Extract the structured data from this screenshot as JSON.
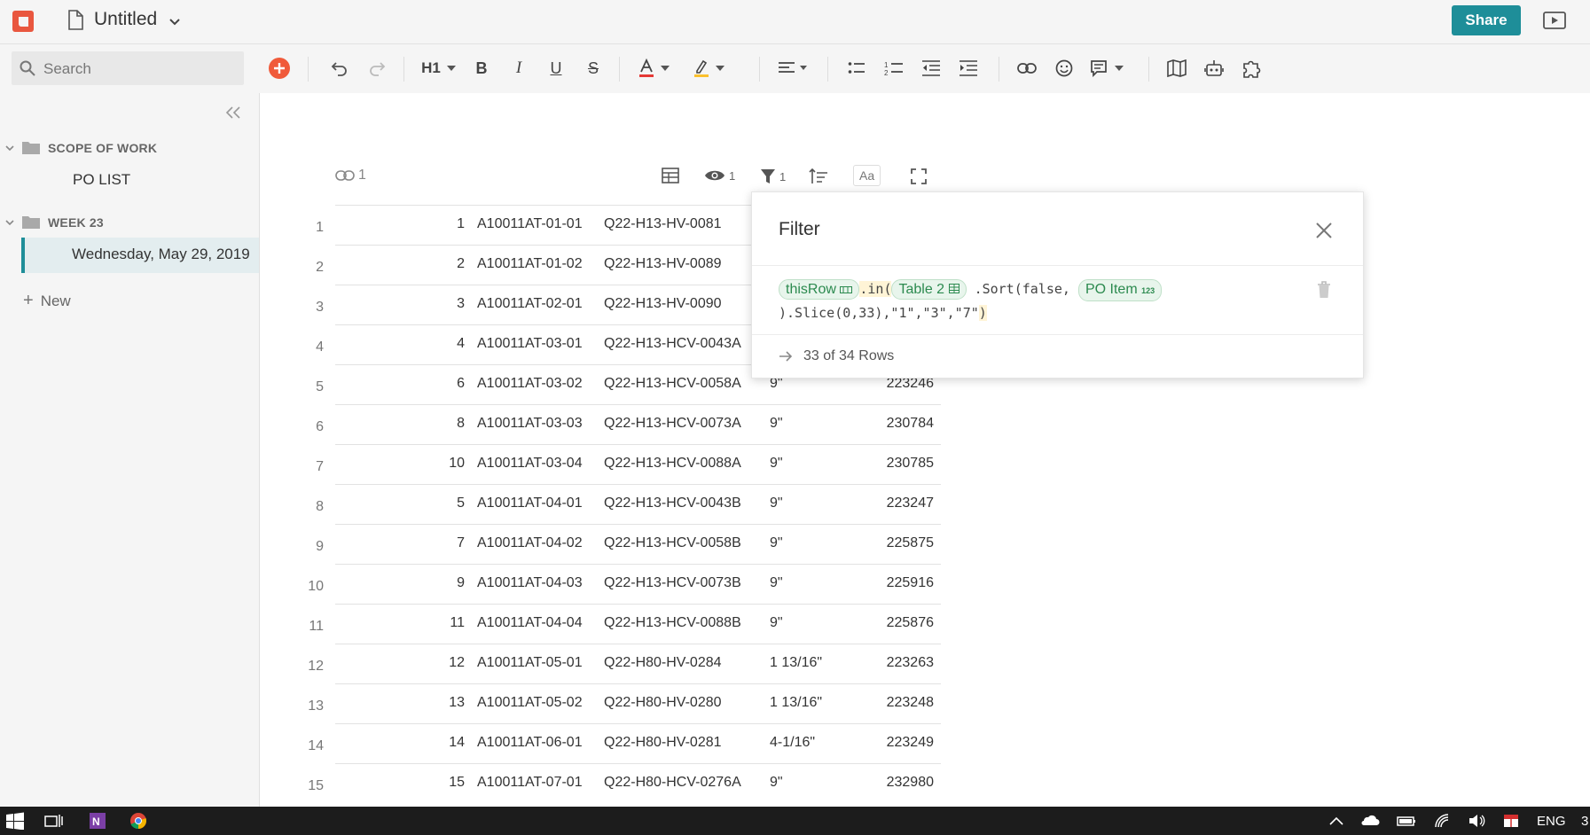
{
  "app": {
    "doc_title": "Untitled",
    "share_label": "Share"
  },
  "sidebar": {
    "search_placeholder": "Search",
    "folders": [
      {
        "label": "SCOPE OF WORK",
        "pages": [
          "PO LIST"
        ]
      },
      {
        "label": "WEEK 23",
        "pages": [
          "Wednesday, May 29, 2019"
        ]
      }
    ],
    "new_label": "New"
  },
  "toolbar": {
    "heading_label": "H1",
    "icons": [
      "add-icon",
      "undo-icon",
      "redo-icon",
      "heading-icon",
      "bold-icon",
      "italic-icon",
      "underline-icon",
      "strikethrough-icon",
      "text-color-icon",
      "highlight-icon",
      "align-icon",
      "bullet-list-icon",
      "numbered-list-icon",
      "outdent-icon",
      "indent-icon",
      "link-icon",
      "emoji-icon",
      "comment-icon",
      "map-icon",
      "robot-icon",
      "puzzle-icon"
    ],
    "text_color": "#e53935",
    "highlight_color": "#fbc02d"
  },
  "table_controls": {
    "link_count": "1",
    "visible_count": "1",
    "filter_count": "1",
    "font_label": "Aa"
  },
  "rows": [
    {
      "num": "1",
      "c1": "1",
      "c2": "A10011AT-01-01",
      "c3": "Q22-H13-HV-0081",
      "c4": "",
      "c5": ""
    },
    {
      "num": "2",
      "c1": "2",
      "c2": "A10011AT-01-02",
      "c3": "Q22-H13-HV-0089",
      "c4": "",
      "c5": ""
    },
    {
      "num": "3",
      "c1": "3",
      "c2": "A10011AT-02-01",
      "c3": "Q22-H13-HV-0090",
      "c4": "",
      "c5": ""
    },
    {
      "num": "4",
      "c1": "4",
      "c2": "A10011AT-03-01",
      "c3": "Q22-H13-HCV-0043A",
      "c4": "",
      "c5": ""
    },
    {
      "num": "5",
      "c1": "6",
      "c2": "A10011AT-03-02",
      "c3": "Q22-H13-HCV-0058A",
      "c4": "9\"",
      "c5": "223246"
    },
    {
      "num": "6",
      "c1": "8",
      "c2": "A10011AT-03-03",
      "c3": "Q22-H13-HCV-0073A",
      "c4": "9\"",
      "c5": "230784"
    },
    {
      "num": "7",
      "c1": "10",
      "c2": "A10011AT-03-04",
      "c3": "Q22-H13-HCV-0088A",
      "c4": "9\"",
      "c5": "230785"
    },
    {
      "num": "8",
      "c1": "5",
      "c2": "A10011AT-04-01",
      "c3": "Q22-H13-HCV-0043B",
      "c4": "9\"",
      "c5": "223247"
    },
    {
      "num": "9",
      "c1": "7",
      "c2": "A10011AT-04-02",
      "c3": "Q22-H13-HCV-0058B",
      "c4": "9\"",
      "c5": "225875"
    },
    {
      "num": "10",
      "c1": "9",
      "c2": "A10011AT-04-03",
      "c3": "Q22-H13-HCV-0073B",
      "c4": "9\"",
      "c5": "225916"
    },
    {
      "num": "11",
      "c1": "11",
      "c2": "A10011AT-04-04",
      "c3": "Q22-H13-HCV-0088B",
      "c4": "9\"",
      "c5": "225876"
    },
    {
      "num": "12",
      "c1": "12",
      "c2": "A10011AT-05-01",
      "c3": "Q22-H80-HV-0284",
      "c4": "1 13/16\"",
      "c5": "223263"
    },
    {
      "num": "13",
      "c1": "13",
      "c2": "A10011AT-05-02",
      "c3": "Q22-H80-HV-0280",
      "c4": "1 13/16\"",
      "c5": "223248"
    },
    {
      "num": "14",
      "c1": "14",
      "c2": "A10011AT-06-01",
      "c3": "Q22-H80-HV-0281",
      "c4": "4-1/16\"",
      "c5": "223249"
    },
    {
      "num": "15",
      "c1": "15",
      "c2": "A10011AT-07-01",
      "c3": "Q22-H80-HCV-0276A",
      "c4": "9\"",
      "c5": "232980"
    }
  ],
  "filter": {
    "title": "Filter",
    "chip_this_row": "thisRow",
    "code_in": ".in(",
    "chip_table": "Table 2",
    "code_sort": ".Sort(false,",
    "chip_po_item": "PO Item",
    "po_item_badge": "123",
    "code_slice": ").Slice(0,33),\"1\",\"3\",\"7\"",
    "code_close": ")",
    "result": "33 of 34 Rows"
  },
  "taskbar": {
    "lang": "ENG",
    "clock_partial": "3"
  }
}
